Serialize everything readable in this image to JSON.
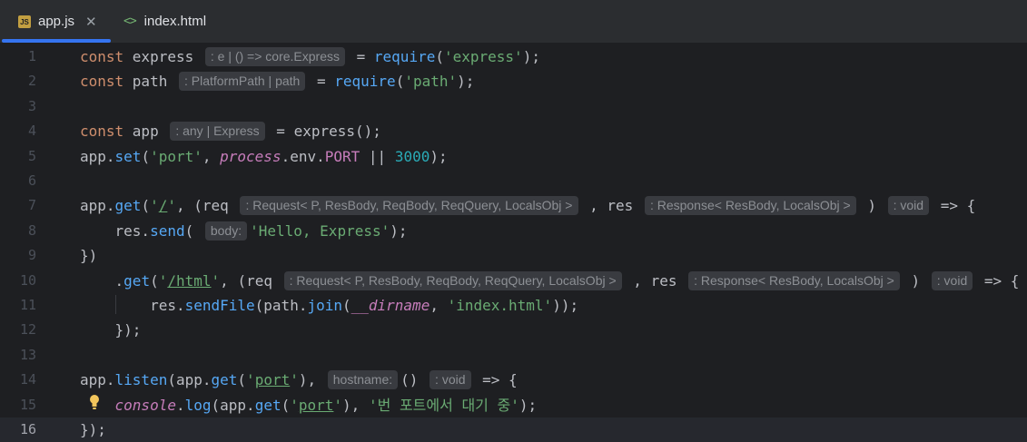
{
  "tabs": [
    {
      "label": "app.js",
      "icon": "js-file-icon",
      "badge": "JS",
      "active": true,
      "closable": true
    },
    {
      "label": "index.html",
      "icon": "html-file-icon",
      "active": false,
      "closable": false
    }
  ],
  "editor": {
    "current_line": 16,
    "lines": [
      {
        "n": "1",
        "tokens": [
          [
            "kw",
            "const "
          ],
          [
            "",
            "express "
          ],
          [
            "hint",
            ": e | () => core.Express"
          ],
          [
            "",
            " = "
          ],
          [
            "fn",
            "require"
          ],
          [
            "",
            "("
          ],
          [
            "str",
            "'express'"
          ],
          [
            "",
            ");"
          ]
        ]
      },
      {
        "n": "2",
        "tokens": [
          [
            "kw",
            "const "
          ],
          [
            "",
            "path "
          ],
          [
            "hint",
            ": PlatformPath | path"
          ],
          [
            "",
            " = "
          ],
          [
            "fn",
            "require"
          ],
          [
            "",
            "("
          ],
          [
            "str",
            "'path'"
          ],
          [
            "",
            ");"
          ]
        ]
      },
      {
        "n": "3",
        "tokens": []
      },
      {
        "n": "4",
        "tokens": [
          [
            "kw",
            "const "
          ],
          [
            "",
            "app "
          ],
          [
            "hint",
            ": any | Express"
          ],
          [
            "",
            " = "
          ],
          [
            "",
            "express();"
          ]
        ]
      },
      {
        "n": "5",
        "tokens": [
          [
            "",
            "app."
          ],
          [
            "fn",
            "set"
          ],
          [
            "",
            "("
          ],
          [
            "str",
            "'port'"
          ],
          [
            "",
            ", "
          ],
          [
            "gl",
            "process"
          ],
          [
            "",
            "."
          ],
          [
            "",
            "env."
          ],
          [
            "prop",
            "PORT"
          ],
          [
            "",
            " || "
          ],
          [
            "num",
            "3000"
          ],
          [
            "",
            ");"
          ]
        ]
      },
      {
        "n": "6",
        "tokens": []
      },
      {
        "n": "7",
        "tokens": [
          [
            "",
            "app."
          ],
          [
            "fn",
            "get"
          ],
          [
            "",
            "("
          ],
          [
            "str",
            "'"
          ],
          [
            "stru",
            "/"
          ],
          [
            "str",
            "'"
          ],
          [
            "",
            ", (req "
          ],
          [
            "hint",
            ": Request< P, ResBody, ReqBody, ReqQuery, LocalsObj >"
          ],
          [
            "",
            " , res "
          ],
          [
            "hint",
            ": Response< ResBody, LocalsObj >"
          ],
          [
            "",
            " ) "
          ],
          [
            "hint",
            ": void"
          ],
          [
            "",
            " => {"
          ]
        ]
      },
      {
        "n": "8",
        "tokens": [
          [
            "",
            "    res."
          ],
          [
            "fn",
            "send"
          ],
          [
            "",
            "( "
          ],
          [
            "hint",
            "body:"
          ],
          [
            "str",
            "'Hello, Express'"
          ],
          [
            "",
            ");"
          ]
        ]
      },
      {
        "n": "9",
        "tokens": [
          [
            "",
            "})"
          ]
        ]
      },
      {
        "n": "10",
        "tokens": [
          [
            "",
            "    ."
          ],
          [
            "fn",
            "get"
          ],
          [
            "",
            "("
          ],
          [
            "str",
            "'"
          ],
          [
            "stru",
            "/html"
          ],
          [
            "str",
            "'"
          ],
          [
            "",
            ", (req "
          ],
          [
            "hint",
            ": Request< P, ResBody, ReqBody, ReqQuery, LocalsObj >"
          ],
          [
            "",
            " , res "
          ],
          [
            "hint",
            ": Response< ResBody, LocalsObj >"
          ],
          [
            "",
            " ) "
          ],
          [
            "hint",
            ": void"
          ],
          [
            "",
            " => {"
          ]
        ]
      },
      {
        "n": "11",
        "tokens": [
          [
            "",
            "        res."
          ],
          [
            "fn",
            "sendFile"
          ],
          [
            "",
            "(path."
          ],
          [
            "fn",
            "join"
          ],
          [
            "",
            "("
          ],
          [
            "gl",
            "__dirname"
          ],
          [
            "",
            ", "
          ],
          [
            "str",
            "'index.html'"
          ],
          [
            "",
            "));"
          ]
        ]
      },
      {
        "n": "12",
        "tokens": [
          [
            "",
            "    });"
          ]
        ]
      },
      {
        "n": "13",
        "tokens": []
      },
      {
        "n": "14",
        "tokens": [
          [
            "",
            "app."
          ],
          [
            "fn",
            "listen"
          ],
          [
            "",
            "(app."
          ],
          [
            "fn",
            "get"
          ],
          [
            "",
            "("
          ],
          [
            "str",
            "'"
          ],
          [
            "stru",
            "port"
          ],
          [
            "str",
            "'"
          ],
          [
            "",
            "), "
          ],
          [
            "hint",
            "hostname:"
          ],
          [
            "",
            "() "
          ],
          [
            "hint",
            ": void"
          ],
          [
            "",
            " => {"
          ]
        ]
      },
      {
        "n": "15",
        "tokens": [
          [
            "",
            "    "
          ],
          [
            "gl",
            "console"
          ],
          [
            "",
            "."
          ],
          [
            "fn",
            "log"
          ],
          [
            "",
            "(app."
          ],
          [
            "fn",
            "get"
          ],
          [
            "",
            "("
          ],
          [
            "str",
            "'"
          ],
          [
            "stru",
            "port"
          ],
          [
            "str",
            "'"
          ],
          [
            "",
            "), "
          ],
          [
            "str",
            "'번 포트에서 대기 중'"
          ],
          [
            "",
            ");"
          ]
        ]
      },
      {
        "n": "16",
        "tokens": [
          [
            "",
            "});"
          ]
        ]
      }
    ]
  },
  "colors": {
    "accent": "#3574f0",
    "keyword": "#cf8e6d",
    "function": "#56a8f5",
    "string": "#6aab73",
    "number": "#2aacb8",
    "global": "#c77dbb"
  },
  "gutter_icons": [
    {
      "line": "15",
      "icon": "lightbulb-icon"
    }
  ]
}
